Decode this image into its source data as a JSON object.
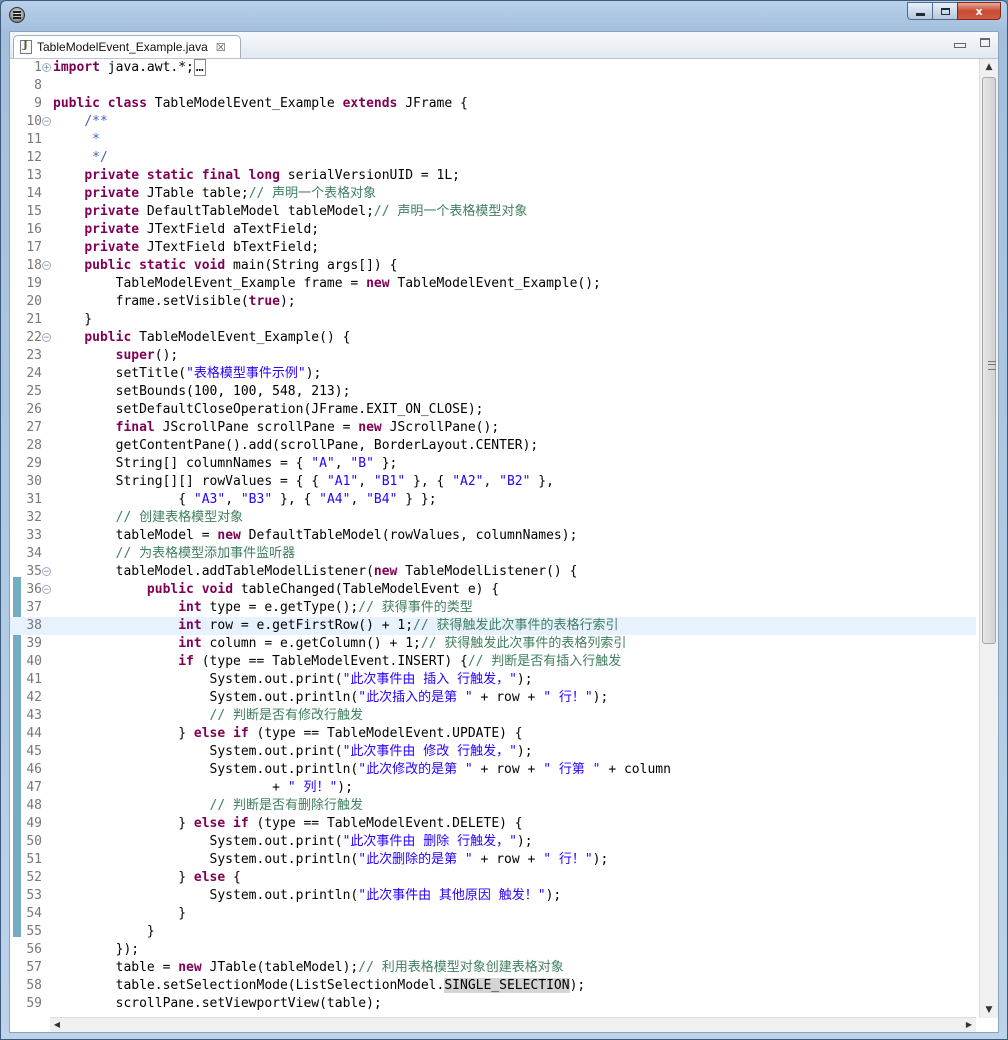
{
  "window": {
    "minimize_icon": "minimize-icon",
    "maximize_icon": "maximize-icon",
    "close_label": "x"
  },
  "tab": {
    "label": "TableModelEvent_Example.java",
    "close": "☒"
  },
  "editor": {
    "current_line": "38",
    "lines": [
      {
        "n": "1",
        "fold": "+",
        "html": "<span class=\"k\">import</span> java.awt.*;<span style=\"border:1px solid #888;padding:0 1px\">…</span>"
      },
      {
        "n": "8",
        "fold": "",
        "html": ""
      },
      {
        "n": "9",
        "fold": "",
        "html": "<span class=\"k\">public class</span> TableModelEvent_Example <span class=\"k\">extends</span> JFrame {"
      },
      {
        "n": "10",
        "fold": "-",
        "html": "    <span class=\"d\">/**</span>"
      },
      {
        "n": "11",
        "fold": "",
        "html": "<span class=\"d\">     *</span>"
      },
      {
        "n": "12",
        "fold": "",
        "html": "<span class=\"d\">     */</span>"
      },
      {
        "n": "13",
        "fold": "",
        "html": "    <span class=\"k\">private static final long</span> serialVersionUID = 1L;"
      },
      {
        "n": "14",
        "fold": "",
        "html": "    <span class=\"k\">private</span> JTable table;<span class=\"c\">// 声明一个表格对象</span>"
      },
      {
        "n": "15",
        "fold": "",
        "html": "    <span class=\"k\">private</span> DefaultTableModel tableModel;<span class=\"c\">// 声明一个表格模型对象</span>"
      },
      {
        "n": "16",
        "fold": "",
        "html": "    <span class=\"k\">private</span> JTextField aTextField;"
      },
      {
        "n": "17",
        "fold": "",
        "html": "    <span class=\"k\">private</span> JTextField bTextField;"
      },
      {
        "n": "18",
        "fold": "-",
        "html": "    <span class=\"k\">public static void</span> main(String args[]) {"
      },
      {
        "n": "19",
        "fold": "",
        "html": "        TableModelEvent_Example frame = <span class=\"k\">new</span> TableModelEvent_Example();"
      },
      {
        "n": "20",
        "fold": "",
        "html": "        frame.setVisible(<span class=\"k\">true</span>);"
      },
      {
        "n": "21",
        "fold": "",
        "html": "    }"
      },
      {
        "n": "22",
        "fold": "-",
        "html": "    <span class=\"k\">public</span> TableModelEvent_Example() {"
      },
      {
        "n": "23",
        "fold": "",
        "html": "        <span class=\"k\">super</span>();"
      },
      {
        "n": "24",
        "fold": "",
        "html": "        setTitle(<span class=\"s\">\"表格模型事件示例\"</span>);"
      },
      {
        "n": "25",
        "fold": "",
        "html": "        setBounds(100, 100, 548, 213);"
      },
      {
        "n": "26",
        "fold": "",
        "html": "        setDefaultCloseOperation(JFrame.EXIT_ON_CLOSE);"
      },
      {
        "n": "27",
        "fold": "",
        "html": "        <span class=\"k\">final</span> JScrollPane scrollPane = <span class=\"k\">new</span> JScrollPane();"
      },
      {
        "n": "28",
        "fold": "",
        "html": "        getContentPane().add(scrollPane, BorderLayout.CENTER);"
      },
      {
        "n": "29",
        "fold": "",
        "html": "        String[] columnNames = { <span class=\"s\">\"A\"</span>, <span class=\"s\">\"B\"</span> };"
      },
      {
        "n": "30",
        "fold": "",
        "html": "        String[][] rowValues = { { <span class=\"s\">\"A1\"</span>, <span class=\"s\">\"B1\"</span> }, { <span class=\"s\">\"A2\"</span>, <span class=\"s\">\"B2\"</span> },"
      },
      {
        "n": "31",
        "fold": "",
        "html": "                { <span class=\"s\">\"A3\"</span>, <span class=\"s\">\"B3\"</span> }, { <span class=\"s\">\"A4\"</span>, <span class=\"s\">\"B4\"</span> } };"
      },
      {
        "n": "32",
        "fold": "",
        "html": "        <span class=\"c\">// 创建表格模型对象</span>"
      },
      {
        "n": "33",
        "fold": "",
        "html": "        tableModel = <span class=\"k\">new</span> DefaultTableModel(rowValues, columnNames);"
      },
      {
        "n": "34",
        "fold": "",
        "html": "        <span class=\"c\">// 为表格模型添加事件监听器</span>"
      },
      {
        "n": "35",
        "fold": "-",
        "html": "        tableModel.addTableModelListener(<span class=\"k\">new</span> TableModelListener() {"
      },
      {
        "n": "36",
        "fold": "-",
        "html": "            <span class=\"k\">public void</span> tableChanged(TableModelEvent e) {"
      },
      {
        "n": "37",
        "fold": "",
        "html": "                <span class=\"k\">int</span> type = e.getType();<span class=\"c\">// 获得事件的类型</span>"
      },
      {
        "n": "38",
        "fold": "",
        "html": "                <span class=\"k\">int</span> row = e.getFirstRow() + 1;<span class=\"c\">// 获得触发此次事件的表格行索引</span>"
      },
      {
        "n": "39",
        "fold": "",
        "html": "                <span class=\"k\">int</span> column = e.getColumn() + 1;<span class=\"c\">// 获得触发此次事件的表格列索引</span>"
      },
      {
        "n": "40",
        "fold": "",
        "html": "                <span class=\"k\">if</span> (type == TableModelEvent.INSERT) {<span class=\"c\">// 判断是否有插入行触发</span>"
      },
      {
        "n": "41",
        "fold": "",
        "html": "                    System.out.print(<span class=\"s\">\"此次事件由 插入 行触发，\"</span>);"
      },
      {
        "n": "42",
        "fold": "",
        "html": "                    System.out.println(<span class=\"s\">\"此次插入的是第 \"</span> + row + <span class=\"s\">\" 行！\"</span>);"
      },
      {
        "n": "43",
        "fold": "",
        "html": "                    <span class=\"c\">// 判断是否有修改行触发</span>"
      },
      {
        "n": "44",
        "fold": "",
        "html": "                } <span class=\"k\">else if</span> (type == TableModelEvent.UPDATE) {"
      },
      {
        "n": "45",
        "fold": "",
        "html": "                    System.out.print(<span class=\"s\">\"此次事件由 修改 行触发，\"</span>);"
      },
      {
        "n": "46",
        "fold": "",
        "html": "                    System.out.println(<span class=\"s\">\"此次修改的是第 \"</span> + row + <span class=\"s\">\" 行第 \"</span> + column"
      },
      {
        "n": "47",
        "fold": "",
        "html": "                            + <span class=\"s\">\" 列！\"</span>);"
      },
      {
        "n": "48",
        "fold": "",
        "html": "                    <span class=\"c\">// 判断是否有删除行触发</span>"
      },
      {
        "n": "49",
        "fold": "",
        "html": "                } <span class=\"k\">else if</span> (type == TableModelEvent.DELETE) {"
      },
      {
        "n": "50",
        "fold": "",
        "html": "                    System.out.print(<span class=\"s\">\"此次事件由 删除 行触发，\"</span>);"
      },
      {
        "n": "51",
        "fold": "",
        "html": "                    System.out.println(<span class=\"s\">\"此次删除的是第 \"</span> + row + <span class=\"s\">\" 行！\"</span>);"
      },
      {
        "n": "52",
        "fold": "",
        "html": "                } <span class=\"k\">else</span> {"
      },
      {
        "n": "53",
        "fold": "",
        "html": "                    System.out.println(<span class=\"s\">\"此次事件由 其他原因 触发！\"</span>);"
      },
      {
        "n": "54",
        "fold": "",
        "html": "                }"
      },
      {
        "n": "55",
        "fold": "",
        "html": "            }"
      },
      {
        "n": "56",
        "fold": "",
        "html": "        });"
      },
      {
        "n": "57",
        "fold": "",
        "html": "        table = <span class=\"k\">new</span> JTable(tableModel);<span class=\"c\">// 利用表格模型对象创建表格对象</span>"
      },
      {
        "n": "58",
        "fold": "",
        "html": "        table.setSelectionMode(ListSelectionModel.<span class=\"mark\">SINGLE_SELECTION</span>);"
      },
      {
        "n": "59",
        "fold": "",
        "html": "        scrollPane.setViewportView(table);"
      }
    ]
  }
}
